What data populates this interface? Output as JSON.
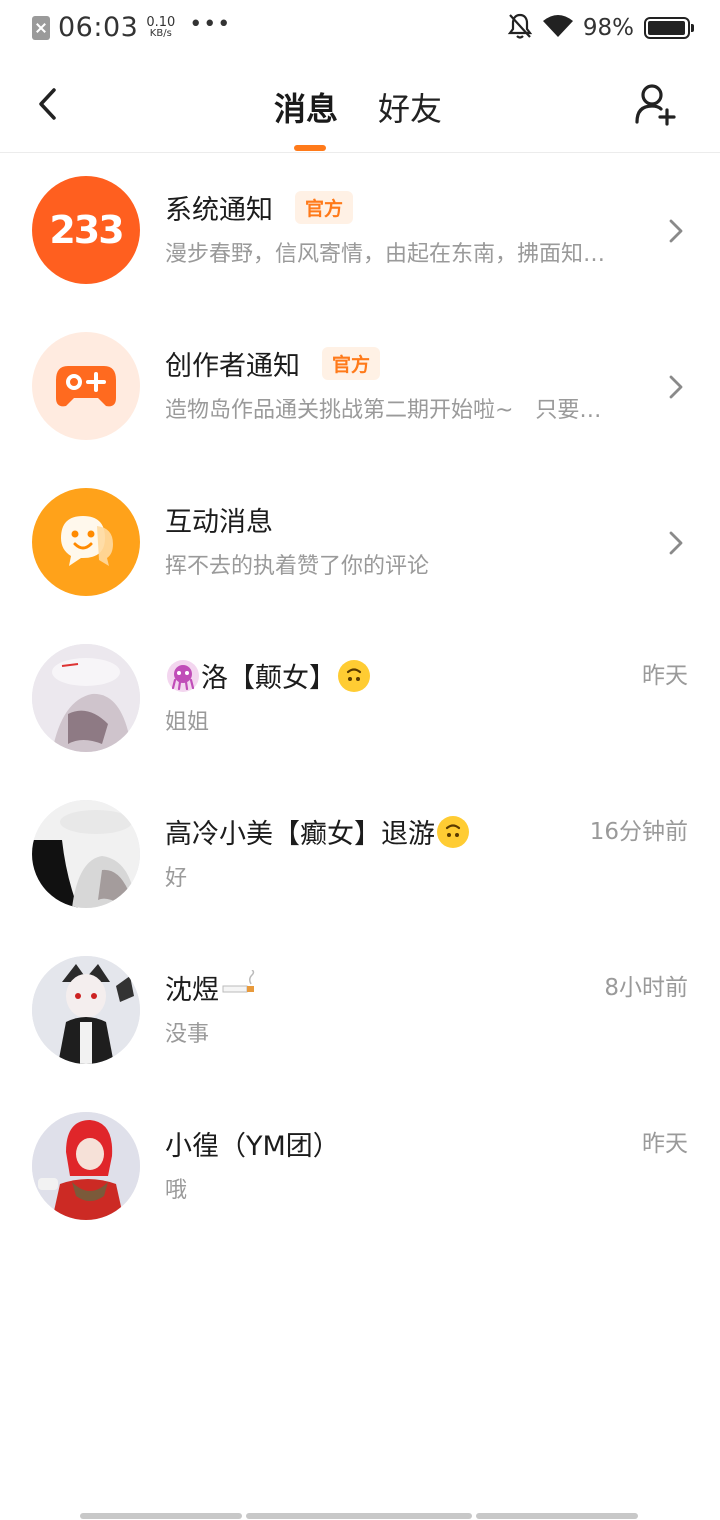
{
  "status_bar": {
    "time": "06:03",
    "net_speed_value": "0.10",
    "net_speed_unit": "KB/s",
    "more": "•••",
    "battery_pct": "98%",
    "battery_level": 0.98
  },
  "header": {
    "tabs": [
      {
        "label": "消息",
        "active": true
      },
      {
        "label": "好友",
        "active": false
      }
    ],
    "accent": "#ff7a1a"
  },
  "system_rows": [
    {
      "title": "系统通知",
      "badge": "官方",
      "subtitle": "漫步春野，信风寄情，由起在东南，拂面知…",
      "avatar_text": "233"
    },
    {
      "title": "创作者通知",
      "badge": "官方",
      "subtitle": "造物岛作品通关挑战第二期开始啦~　只要…"
    },
    {
      "title": "互动消息",
      "subtitle": "挥不去的执着赞了你的评论"
    }
  ],
  "chats": [
    {
      "name": "洛【颠女】",
      "message": "姐姐",
      "time": "昨天"
    },
    {
      "name": "高冷小美【癫女】退游",
      "message": "好",
      "time": "16分钟前"
    },
    {
      "name": "沈煜",
      "message": "没事",
      "time": "8小时前"
    },
    {
      "name": "小徨（YM团）",
      "message": "哦",
      "time": "昨天"
    }
  ]
}
